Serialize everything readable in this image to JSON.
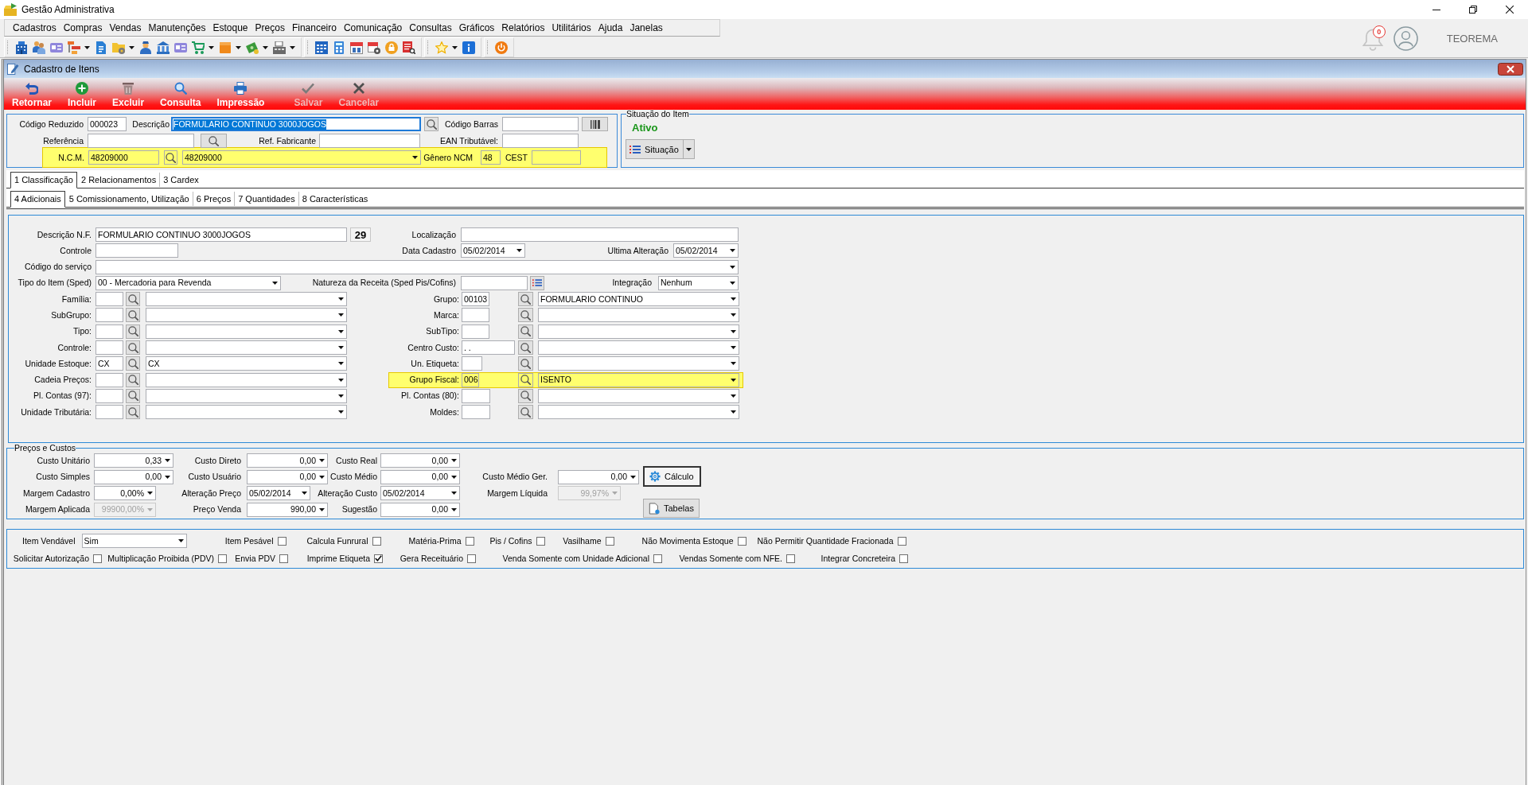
{
  "app": {
    "title": "Gestão Administrativa"
  },
  "menu": [
    "Cadastros",
    "Compras",
    "Vendas",
    "Manutenções",
    "Estoque",
    "Preços",
    "Financeiro",
    "Comunicação",
    "Consultas",
    "Gráficos",
    "Relatórios",
    "Utilitários",
    "Ajuda",
    "Janelas"
  ],
  "user_area": {
    "notifications": "0",
    "user": "TEOREMA"
  },
  "window": {
    "title": "Cadastro de Itens"
  },
  "actions": [
    {
      "label": "Retornar",
      "disabled": false
    },
    {
      "label": "Incluir",
      "disabled": false
    },
    {
      "label": "Excluir",
      "disabled": false
    },
    {
      "label": "Consulta",
      "disabled": false
    },
    {
      "label": "Impressão",
      "disabled": false
    },
    {
      "label": "Salvar",
      "disabled": true
    },
    {
      "label": "Cancelar",
      "disabled": true
    }
  ],
  "header": {
    "codigo_reduzido": {
      "label": "Código Reduzido",
      "value": "000023"
    },
    "descricao": {
      "label": "Descrição",
      "value": "FORMULARIO CONTINUO 3000JOGOS",
      "focused": true
    },
    "codigo_barras": {
      "label": "Código Barras"
    },
    "referencia": {
      "label": "Referência"
    },
    "ref_fabricante": {
      "label": "Ref. Fabricante"
    },
    "ean_tributavel": {
      "label": "EAN Tributável:"
    },
    "ncm_row": {
      "highlighted": true,
      "ncm_label": "N.C.M.",
      "ncm_code": "48209000",
      "ncm_description": "48209000",
      "genero_label": "Gênero NCM",
      "genero_value": "48",
      "cest_label": "CEST"
    }
  },
  "situacao": {
    "legend": "Situação do Item",
    "status": "Ativo",
    "button": "Situação"
  },
  "tabs": [
    {
      "label": "1 Classificação",
      "selected": true
    },
    {
      "label": "2 Relacionamentos",
      "selected": false
    },
    {
      "label": "3 Cardex",
      "selected": false
    }
  ],
  "subtabs": [
    {
      "label": "4 Adicionais",
      "selected": true
    },
    {
      "label": "5 Comissionamento, Utilização",
      "selected": false
    },
    {
      "label": "6 Preços",
      "selected": false
    },
    {
      "label": "7 Quantidades",
      "selected": false
    },
    {
      "label": "8 Características",
      "selected": false
    }
  ],
  "adicionais": {
    "descricao_nf": {
      "label": "Descrição N.F.",
      "value": "FORMULARIO CONTINUO 3000JOGOS",
      "count": "29"
    },
    "localizacao": {
      "label": "Localização"
    },
    "controle": {
      "label": "Controle"
    },
    "data_cadastro": {
      "label": "Data Cadastro",
      "value": "05/02/2014"
    },
    "ultima_alteracao": {
      "label": "Ultima Alteração",
      "value": "05/02/2014"
    },
    "codigo_servico": {
      "label": "Código do serviço"
    },
    "tipo_item": {
      "label": "Tipo do Item (Sped)",
      "value": "00 - Mercadoria para Revenda"
    },
    "natureza_receita": {
      "label": "Natureza da Receita (Sped Pis/Cofins)"
    },
    "integracao": {
      "label": "Integração",
      "value": "Nenhum"
    },
    "lookups_left": [
      {
        "label": "Família:",
        "highlighted": false
      },
      {
        "label": "SubGrupo:",
        "highlighted": false
      },
      {
        "label": "Tipo:",
        "highlighted": false
      },
      {
        "label": "Controle:",
        "highlighted": false
      },
      {
        "label": "Unidade Estoque:",
        "code": "CX",
        "name": "CX",
        "highlighted": false
      },
      {
        "label": "Cadeia Preços:",
        "highlighted": false
      },
      {
        "label": "Pl. Contas (97):",
        "highlighted": false
      },
      {
        "label": "Unidade Tributária:",
        "highlighted": false
      }
    ],
    "lookups_right": [
      {
        "label": "Grupo:",
        "code": "00103",
        "name": "FORMULARIO CONTINUO",
        "highlighted": false
      },
      {
        "label": "Marca:",
        "highlighted": false
      },
      {
        "label": "SubTipo:",
        "highlighted": false
      },
      {
        "label": "Centro Custo:",
        "code": ". .",
        "highlighted": false
      },
      {
        "label": "Un. Etiqueta:",
        "highlighted": false
      },
      {
        "label": "Grupo Fiscal:",
        "code": "006",
        "name": "ISENTO",
        "highlighted": true
      },
      {
        "label": "Pl. Contas (80):",
        "highlighted": false
      },
      {
        "label": "Moldes:",
        "highlighted": false
      }
    ]
  },
  "precos_custos": {
    "legend": "Preços e Custos",
    "rows": [
      [
        {
          "label": "Custo Unitário",
          "value": "0,33",
          "kind": "amount",
          "disabled": false
        },
        {
          "label": "Custo Direto",
          "value": "0,00",
          "kind": "amount",
          "disabled": false
        },
        {
          "label": "Custo Real",
          "value": "0,00",
          "kind": "amount",
          "disabled": false
        }
      ],
      [
        {
          "label": "Custo Simples",
          "value": "0,00",
          "kind": "amount",
          "disabled": false
        },
        {
          "label": "Custo Usuário",
          "value": "0,00",
          "kind": "amount",
          "disabled": false
        },
        {
          "label": "Custo Médio",
          "value": "0,00",
          "kind": "amount",
          "disabled": false
        },
        {
          "label": "Custo Médio Ger.",
          "value": "0,00",
          "kind": "amount",
          "disabled": false
        }
      ],
      [
        {
          "label": "Margem Cadastro",
          "value": "0,00%",
          "kind": "amount",
          "disabled": false
        },
        {
          "label": "Alteração Preço",
          "value": "05/02/2014",
          "kind": "date",
          "disabled": false
        },
        {
          "label": "Alteração Custo",
          "value": "05/02/2014",
          "kind": "date",
          "disabled": false
        },
        {
          "label": "Margem Líquida",
          "value": "99,97%",
          "kind": "amount",
          "disabled": true
        }
      ],
      [
        {
          "label": "Margem Aplicada",
          "value": "99900,00%",
          "kind": "amount",
          "disabled": true
        },
        {
          "label": "Preço Venda",
          "value": "990,00",
          "kind": "amount",
          "disabled": false
        },
        {
          "label": "Sugestão",
          "value": "0,00",
          "kind": "amount",
          "disabled": false
        }
      ]
    ],
    "buttons": [
      "Cálculo",
      "Tabelas"
    ]
  },
  "options": {
    "item_vendavel": {
      "label": "Item Vendável",
      "value": "Sim"
    },
    "first_line": [
      {
        "label": "Item Pesável",
        "checked": false
      },
      {
        "label": "Calcula Funrural",
        "checked": false
      },
      {
        "label": "Matéria-Prima",
        "checked": false
      },
      {
        "label": "Pis / Cofins",
        "checked": false
      },
      {
        "label": "Vasilhame",
        "checked": false
      },
      {
        "label": "Não Movimenta Estoque",
        "checked": false
      },
      {
        "label": "Não Permitir Quantidade Fracionada",
        "checked": false
      }
    ],
    "second_line": [
      {
        "label": "Solicitar Autorização",
        "checked": false
      },
      {
        "label": "Multiplicação Proibida (PDV)",
        "checked": false
      },
      {
        "label": "Envia PDV",
        "checked": false
      },
      {
        "label": "Imprime Etiqueta",
        "checked": true
      },
      {
        "label": "Gera Receituário",
        "checked": false
      },
      {
        "label": "Venda Somente com Unidade Adicional",
        "checked": false
      },
      {
        "label": "Vendas Somente com NFE.",
        "checked": false
      },
      {
        "label": "Integrar Concreteira",
        "checked": false
      }
    ]
  }
}
